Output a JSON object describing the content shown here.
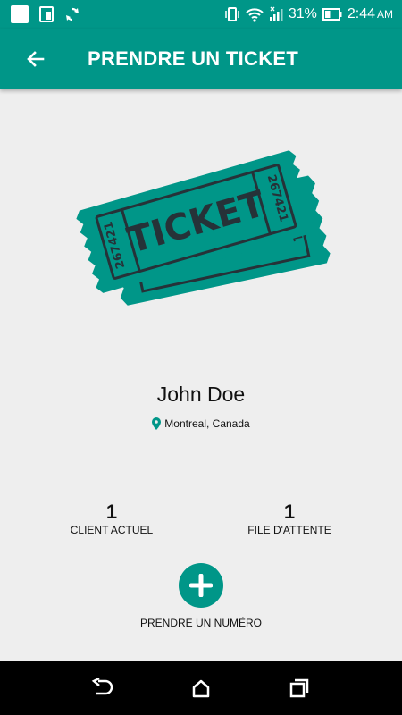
{
  "status_bar": {
    "battery": "31%",
    "time": "2:44",
    "ampm": "AM"
  },
  "app_bar": {
    "title": "PRENDRE UN TICKET"
  },
  "ticket": {
    "label": "TICKET",
    "number": "267421",
    "number_partial": "21"
  },
  "user": {
    "name": "John Doe",
    "location": "Montreal, Canada"
  },
  "stats": {
    "current": {
      "value": "1",
      "label": "CLIENT ACTUEL"
    },
    "queue": {
      "value": "1",
      "label": "FILE D'ATTENTE"
    }
  },
  "action": {
    "label": "PRENDRE UN NUMÉRO"
  },
  "colors": {
    "primary": "#009688",
    "background": "#eeeeee"
  }
}
